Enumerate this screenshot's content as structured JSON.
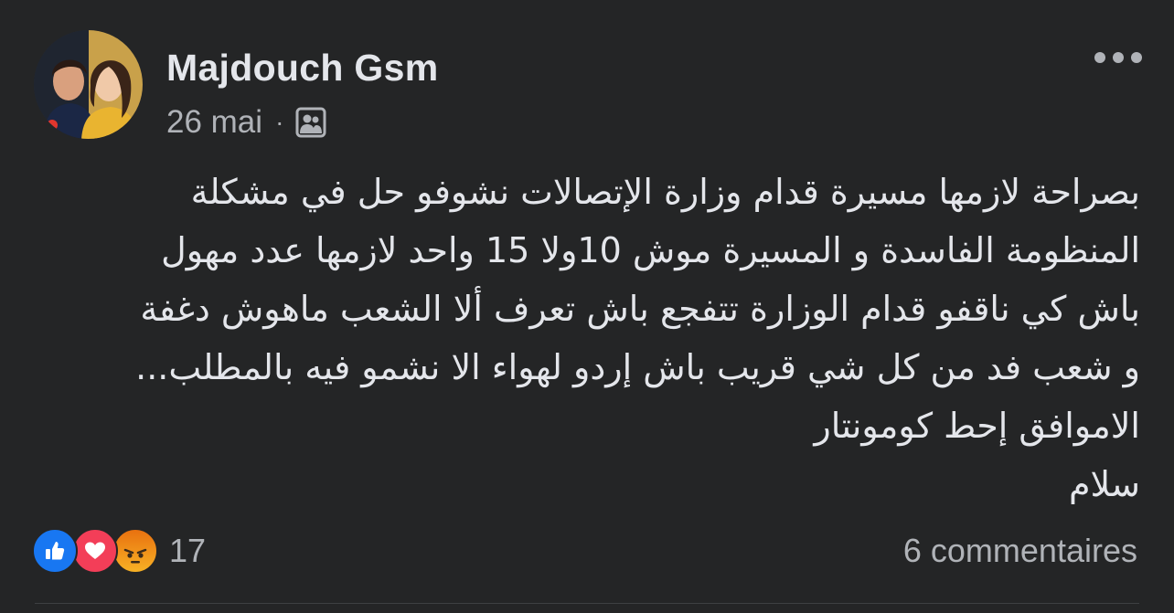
{
  "post": {
    "author": "Majdouch Gsm",
    "date": "26 mai",
    "separator": "·",
    "audience_icon": "friends-icon",
    "text_lines": [
      "بصراحة لازمها مسيرة قدام وزارة الإتصالات نشوفو حل في مشكلة",
      "المنظومة الفاسدة و المسيرة موش 10ولا 15 واحد لازمها عدد مهول",
      "باش كي ناقفو قدام الوزارة تتفجع باش  تعرف ألا الشعب ماهوش دغفة",
      "و شعب فد من كل شي قريب باش إردو لهواء الا نشمو فيه بالمطلب...",
      "الاموافق إحط كومونتار",
      "سلام"
    ],
    "reactions": {
      "types": [
        "like-icon",
        "love-icon",
        "angry-icon"
      ],
      "count": "17"
    },
    "comments": "6 commentaires"
  },
  "colors": {
    "background": "#242526",
    "primary_text": "#e4e6eb",
    "secondary_text": "#b0b3b8",
    "like": "#1877f2",
    "love": "#f33e58",
    "angry": "#f7b125"
  }
}
